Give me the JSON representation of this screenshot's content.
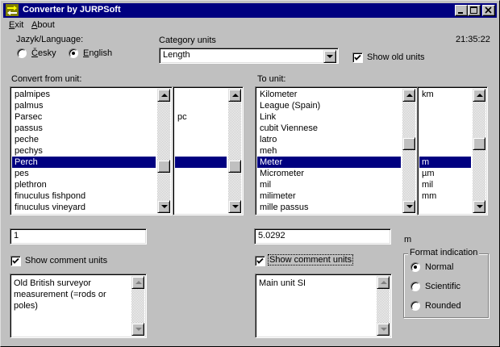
{
  "window": {
    "title": "Converter by JURPSoft",
    "minimize_glyph": "_",
    "maximize_glyph": "□",
    "close_glyph": "×"
  },
  "menu": [
    {
      "label": "Exit",
      "underline": "E",
      "rest": "xit"
    },
    {
      "label": "About",
      "underline": "A",
      "rest": "bout"
    }
  ],
  "clock": "21:35:22",
  "language": {
    "label": "Jazyk/Language:",
    "options": [
      {
        "label": "Česky",
        "underline": "Č",
        "rest": "esky",
        "selected": false
      },
      {
        "label": "English",
        "underline": "E",
        "rest": "nglish",
        "selected": true
      }
    ]
  },
  "category": {
    "label": "Category units",
    "value": "Length"
  },
  "show_old_units": {
    "label": "Show old units",
    "checked": true
  },
  "from": {
    "label": "Convert from unit:",
    "units": [
      "palmipes",
      "palmus",
      "Parsec",
      "passus",
      "peche",
      "pechys",
      "Perch",
      "pes",
      "plethron",
      "finuculus fishpond",
      "finuculus vineyard"
    ],
    "symbols": [
      "",
      "",
      "pc",
      "",
      "",
      "",
      "",
      "",
      "",
      "",
      ""
    ],
    "selected_index": 6,
    "value": "1",
    "show_comment": {
      "label": "Show comment units",
      "checked": true
    },
    "comment": "Old British surveyor measurement (=rods or poles)"
  },
  "to": {
    "label": "To unit:",
    "units": [
      "Kilometer",
      "League (Spain)",
      "Link",
      "cubit Viennese",
      "latro",
      "meh",
      "Meter",
      "Micrometer",
      "mil",
      "milimeter",
      "mille passus"
    ],
    "symbols": [
      "km",
      "",
      "",
      "",
      "",
      "",
      "m",
      "µm",
      "mil",
      "mm",
      ""
    ],
    "selected_index": 6,
    "value": "5.0292",
    "result_unit": "m",
    "show_comment": {
      "label": "Show comment units",
      "checked": true
    },
    "comment": "Main unit SI"
  },
  "format": {
    "title": "Format indication",
    "options": [
      {
        "label": "Normal",
        "selected": true
      },
      {
        "label": "Scientific",
        "selected": false
      },
      {
        "label": "Rounded",
        "selected": false
      }
    ]
  },
  "colors": {
    "face": "#c0c0c0",
    "title_bar": "#000080",
    "selection": "#000080"
  }
}
